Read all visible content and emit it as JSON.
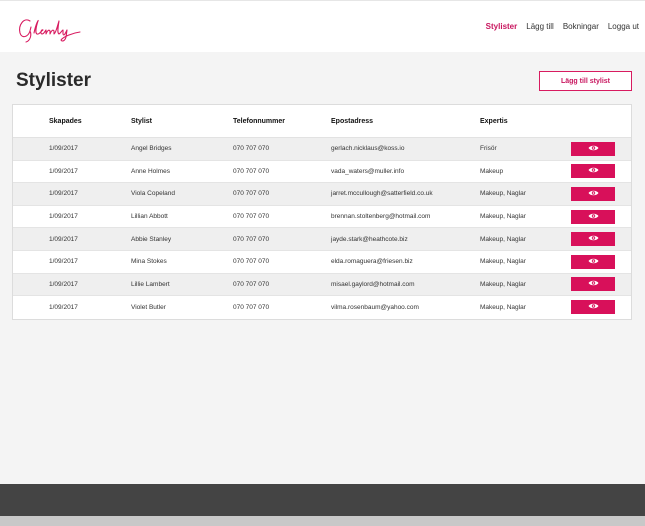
{
  "brand": {
    "logo_text": "Glamly",
    "accent": "#d81b60"
  },
  "nav": {
    "items": [
      {
        "label": "Stylister",
        "active": true
      },
      {
        "label": "Lägg till",
        "active": false
      },
      {
        "label": "Bokningar",
        "active": false
      },
      {
        "label": "Logga ut",
        "active": false
      }
    ]
  },
  "page": {
    "title": "Stylister",
    "add_button": "Lägg till stylist"
  },
  "table": {
    "headers": [
      "Skapades",
      "Stylist",
      "Telefonnummer",
      "Epostadress",
      "Expertis"
    ],
    "view_icon": "eye-icon",
    "rows": [
      {
        "created": "1/09/2017",
        "stylist": "Angel Bridges",
        "phone": "070 707 070",
        "email": "gerlach.nicklaus@koss.io",
        "expertise": "Frisör"
      },
      {
        "created": "1/09/2017",
        "stylist": "Anne Holmes",
        "phone": "070 707 070",
        "email": "vada_waters@muller.info",
        "expertise": "Makeup"
      },
      {
        "created": "1/09/2017",
        "stylist": "Viola Copeland",
        "phone": "070 707 070",
        "email": "jarret.mccullough@satterfield.co.uk",
        "expertise": "Makeup, Naglar"
      },
      {
        "created": "1/09/2017",
        "stylist": "Lillian Abbott",
        "phone": "070 707 070",
        "email": "brennan.stoltenberg@hotmail.com",
        "expertise": "Makeup, Naglar"
      },
      {
        "created": "1/09/2017",
        "stylist": "Abbie Stanley",
        "phone": "070 707 070",
        "email": "jayde.stark@heathcote.biz",
        "expertise": "Makeup, Naglar"
      },
      {
        "created": "1/09/2017",
        "stylist": "Mina Stokes",
        "phone": "070 707 070",
        "email": "elda.romaguera@friesen.biz",
        "expertise": "Makeup, Naglar"
      },
      {
        "created": "1/09/2017",
        "stylist": "Lillie Lambert",
        "phone": "070 707 070",
        "email": "misael.gaylord@hotmail.com",
        "expertise": "Makeup, Naglar"
      },
      {
        "created": "1/09/2017",
        "stylist": "Violet Butler",
        "phone": "070 707 070",
        "email": "vilma.rosenbaum@yahoo.com",
        "expertise": "Makeup, Naglar"
      }
    ]
  }
}
